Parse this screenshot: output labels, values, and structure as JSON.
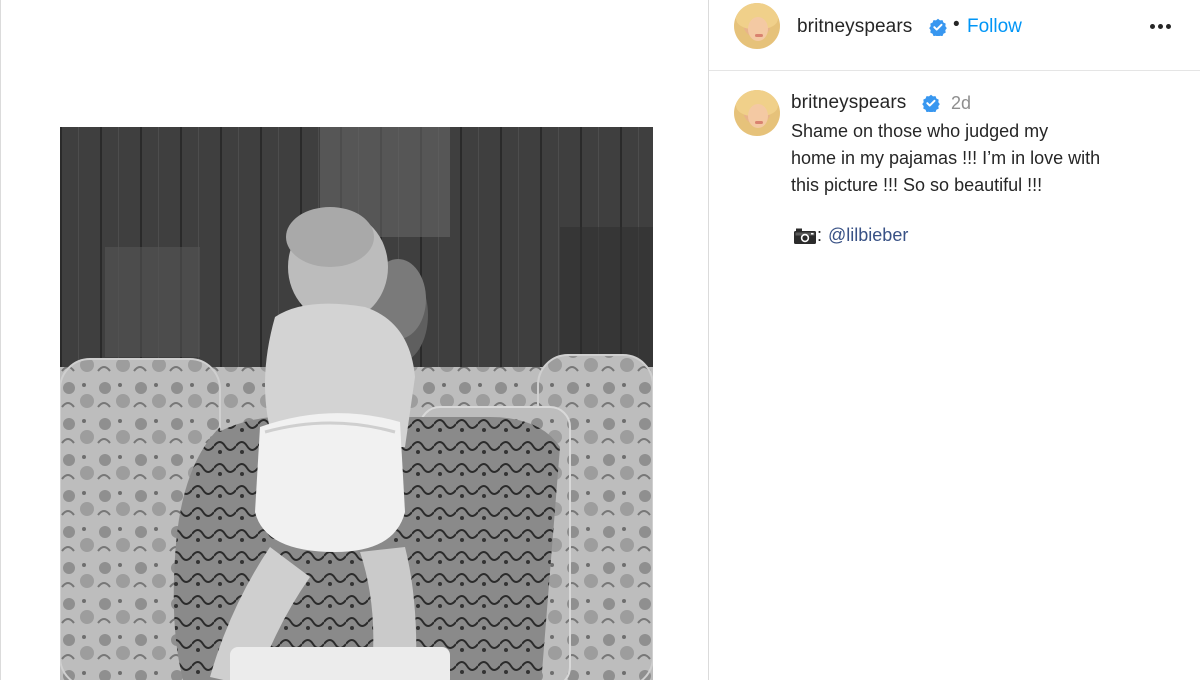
{
  "post": {
    "image_alt": "Black-and-white photo of a baby standing on a man's lap on a floral sofa"
  },
  "header": {
    "username": "britneyspears",
    "separator": "•",
    "follow_label": "Follow",
    "more_icon": "more-options-icon"
  },
  "caption": {
    "username": "britneyspears",
    "time": "2d",
    "text": "Shame on those who judged my\nhome in my pajamas !!! I’m in love with\nthis picture !!! So so beautiful !!!",
    "credit_separator": ":",
    "mention": "@lilbieber"
  },
  "colors": {
    "accent": "#0095f6",
    "verified": "#3897f0",
    "mention": "#385185",
    "muted": "#8e8e8e"
  }
}
